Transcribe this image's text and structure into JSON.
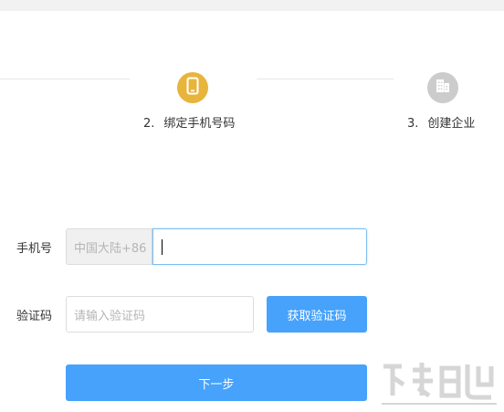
{
  "steps": [
    {
      "number": "2.",
      "label": "绑定手机号码",
      "state": "active",
      "icon": "phone-icon",
      "color": "#e7b53c"
    },
    {
      "number": "3.",
      "label": "创建企业",
      "state": "pending",
      "icon": "building-icon",
      "color": "#cccccc"
    }
  ],
  "form": {
    "phone_label": "手机号",
    "phone_prefix": "中国大陆+86",
    "phone_value": "",
    "code_label": "验证码",
    "code_placeholder": "请输入验证码",
    "get_code_button": "获取验证码",
    "next_button": "下一步"
  },
  "colors": {
    "primary_button": "#47a2fc",
    "focus_border": "#7dbdf0"
  }
}
